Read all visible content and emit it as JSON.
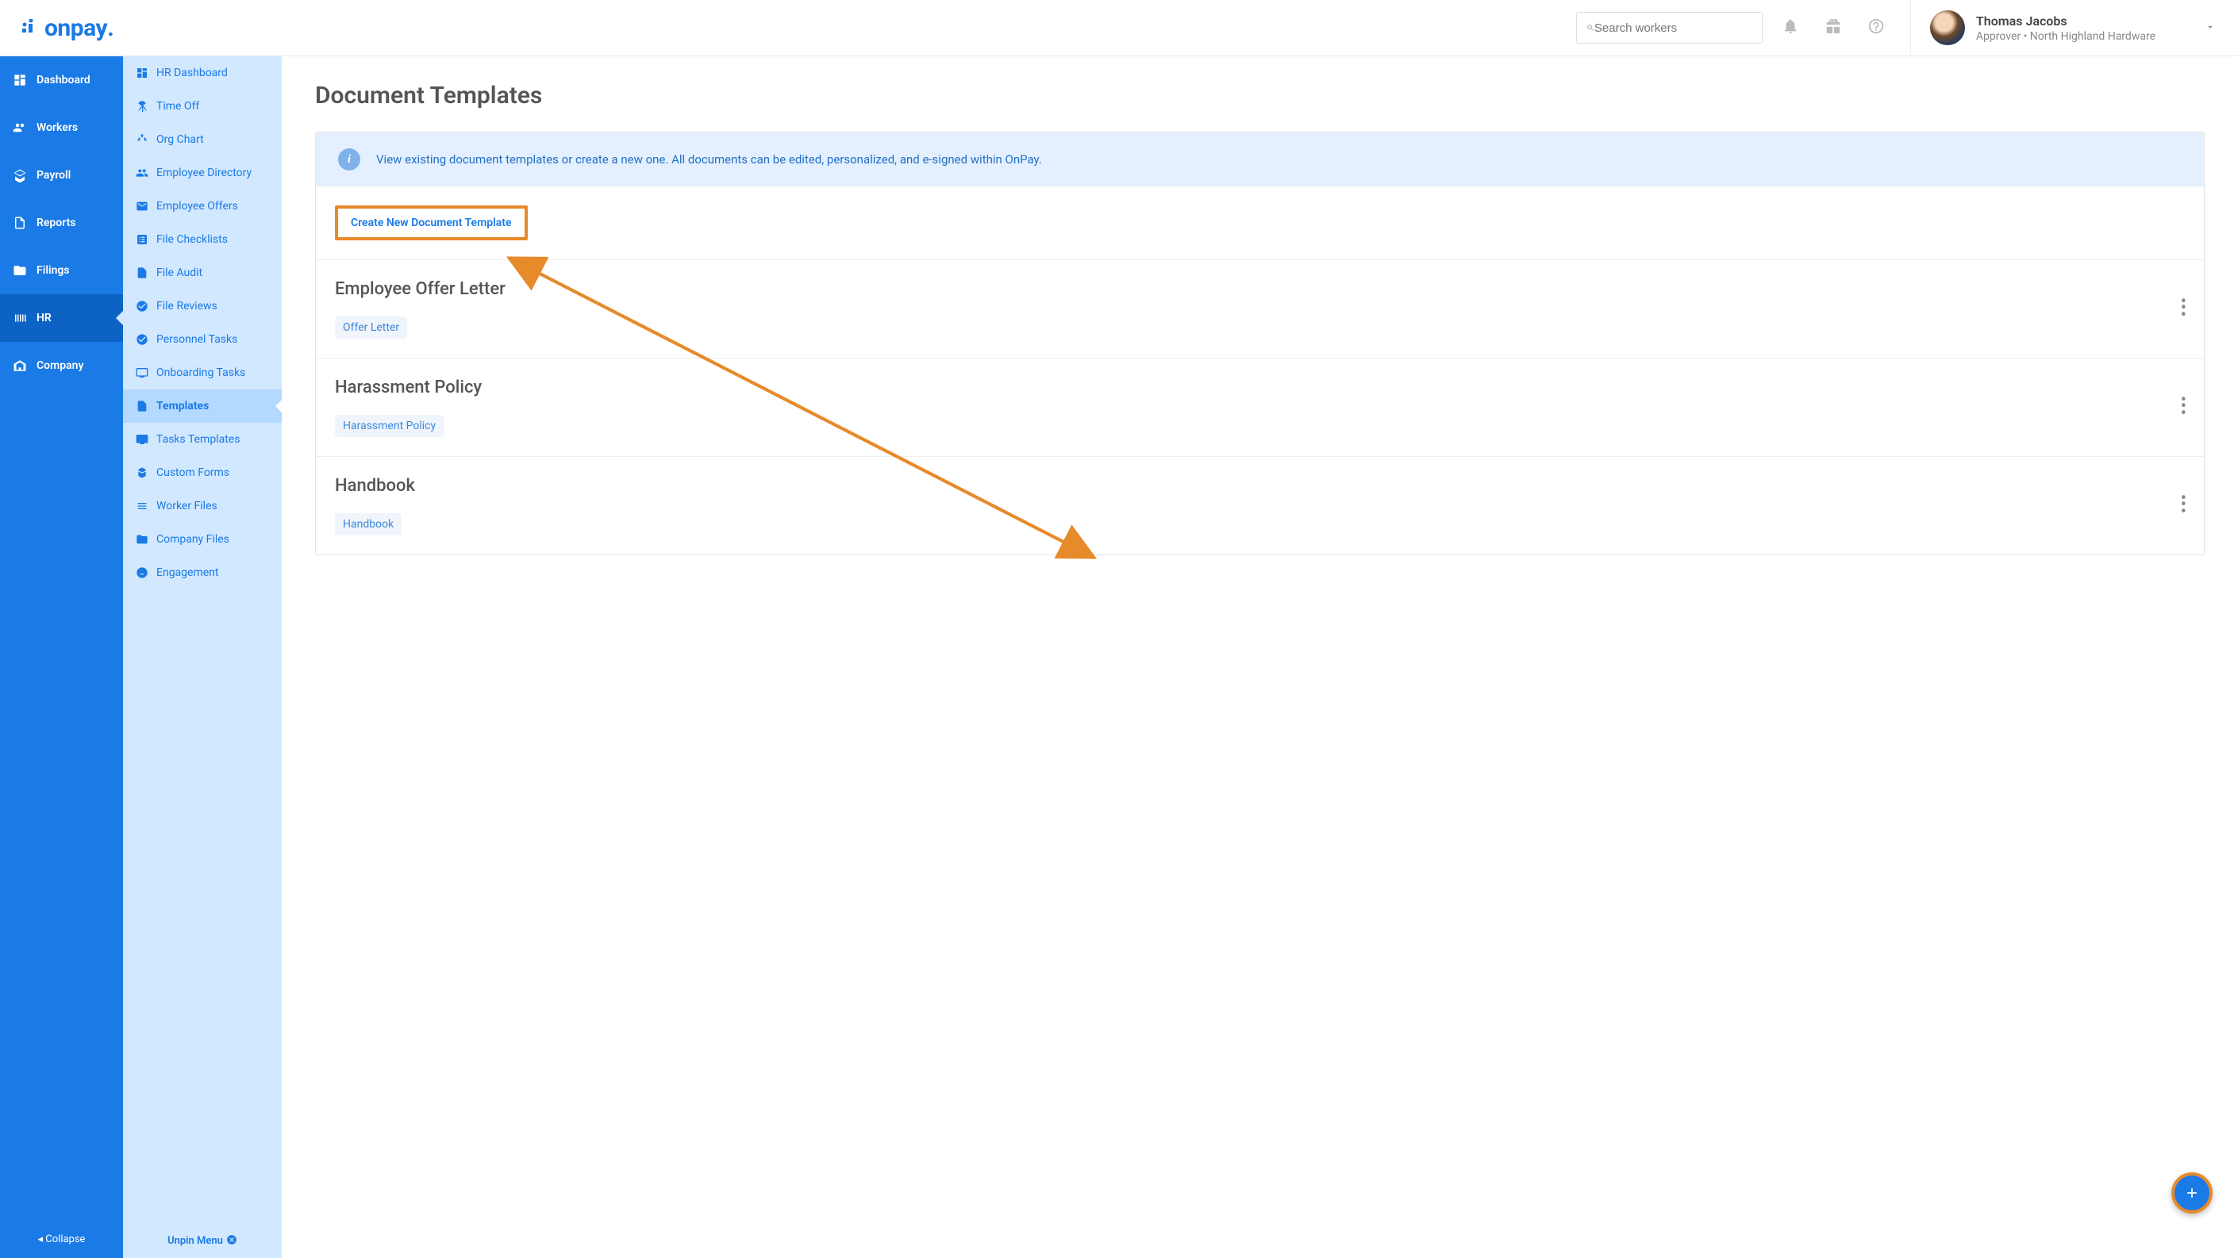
{
  "brand": "onpay",
  "search": {
    "placeholder": "Search workers"
  },
  "user": {
    "name": "Thomas Jacobs",
    "role": "Approver • North Highland Hardware"
  },
  "primaryNav": {
    "items": [
      {
        "label": "Dashboard"
      },
      {
        "label": "Workers"
      },
      {
        "label": "Payroll"
      },
      {
        "label": "Reports"
      },
      {
        "label": "Filings"
      },
      {
        "label": "HR"
      },
      {
        "label": "Company"
      }
    ],
    "collapse": "Collapse"
  },
  "secondaryNav": {
    "items": [
      {
        "label": "HR Dashboard"
      },
      {
        "label": "Time Off"
      },
      {
        "label": "Org Chart"
      },
      {
        "label": "Employee Directory"
      },
      {
        "label": "Employee Offers"
      },
      {
        "label": "File Checklists"
      },
      {
        "label": "File Audit"
      },
      {
        "label": "File Reviews"
      },
      {
        "label": "Personnel Tasks"
      },
      {
        "label": "Onboarding Tasks"
      },
      {
        "label": "Templates"
      },
      {
        "label": "Tasks Templates"
      },
      {
        "label": "Custom Forms"
      },
      {
        "label": "Worker Files"
      },
      {
        "label": "Company Files"
      },
      {
        "label": "Engagement"
      }
    ],
    "unpin": "Unpin Menu"
  },
  "page": {
    "title": "Document Templates",
    "banner": "View existing document templates or create a new one. All documents can be edited, personalized, and e-signed within OnPay.",
    "createButton": "Create New Document Template",
    "templates": [
      {
        "title": "Employee Offer Letter",
        "tag": "Offer Letter"
      },
      {
        "title": "Harassment Policy",
        "tag": "Harassment Policy"
      },
      {
        "title": "Handbook",
        "tag": "Handbook"
      }
    ]
  },
  "colors": {
    "primary": "#1a7ae6",
    "highlight": "#e78a2a"
  }
}
